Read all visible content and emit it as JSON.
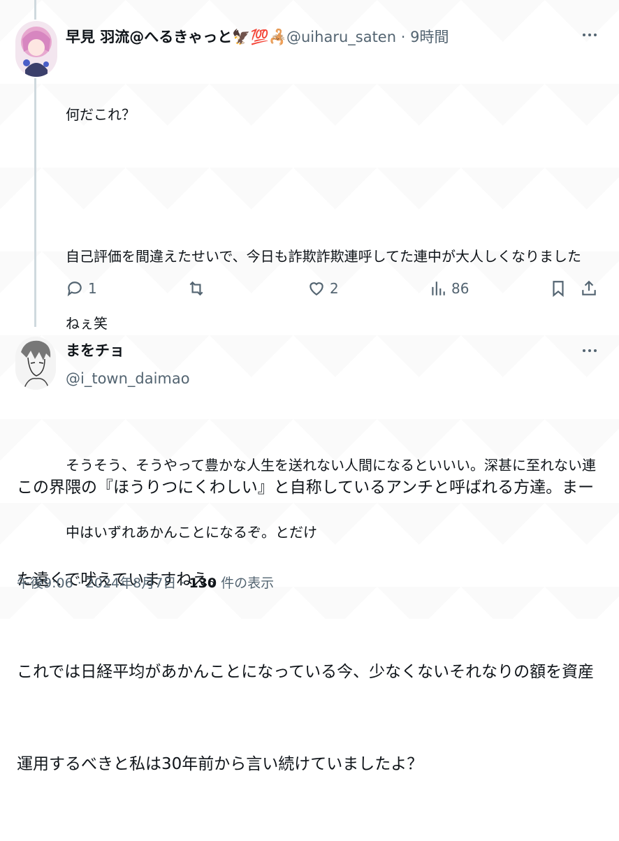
{
  "post1": {
    "display_name": "早見 羽流@へるきゃっと",
    "name_emojis": "🦅💯🦂",
    "handle": "@uiharu_saten",
    "separator": "·",
    "time": "9時間",
    "lines": [
      "何だこれ？",
      "",
      "自己評価を間違えたせいで、今日も詐欺詐欺連呼してた連中が大人しくなりました",
      "ねぇ笑",
      "",
      "そうそう、そうやって豊かな人生を送れない人間になるといいい。深甚に至れない連",
      "中はいずれあかんことになるぞ。とだけ"
    ],
    "replies": "1",
    "reposts": "",
    "likes": "2",
    "views": "86",
    "icons": [
      "reply-icon",
      "repost-icon",
      "like-icon",
      "views-icon",
      "bookmark-icon",
      "share-icon",
      "more-icon"
    ]
  },
  "post2": {
    "display_name": "まをチョ",
    "handle": "@i_town_daimao",
    "lines": [
      "この界隈の『ほうりつにくわしい』と自称しているアンチと呼ばれる方達。まー",
      "た遠くで吠えていますねえ。",
      "これでは日経平均があかんことになっている今、少なくないそれなりの額を資産",
      "運用するべきと私は30年前から言い続けていましたよ？"
    ],
    "meta_time": "午後9:06 · 2024年8月7日 · ",
    "meta_views_count": "130",
    "meta_views_label": " 件の表示"
  },
  "colors": {
    "text": "#0f1419",
    "secondary": "#536471",
    "thread_line": "#cfd9de"
  }
}
